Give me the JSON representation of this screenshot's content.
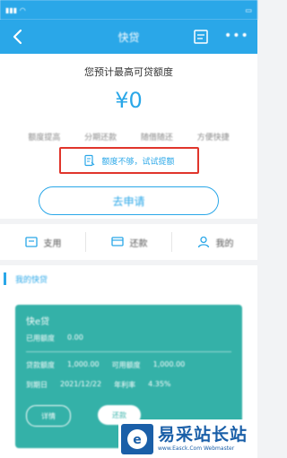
{
  "nav": {
    "title": "快贷"
  },
  "hero": {
    "label": "您预计最高可贷额度",
    "amount": "¥0",
    "features": [
      "额度提高",
      "分期还款",
      "随借随还",
      "方便快捷"
    ]
  },
  "boost": {
    "text": "额度不够，试试提额"
  },
  "apply_button": {
    "label": "去申请"
  },
  "tabs": [
    {
      "label": "支用",
      "icon": "wallet-icon"
    },
    {
      "label": "还款",
      "icon": "repay-icon"
    },
    {
      "label": "我的",
      "icon": "user-icon"
    }
  ],
  "section": {
    "title": "我的快贷"
  },
  "loan_card": {
    "name": "快e贷",
    "row1": [
      "已用额度",
      "0.00"
    ],
    "row2": [
      "贷款额度",
      "1,000.00",
      "可用额度",
      "1,000.00"
    ],
    "row3": [
      "到期日",
      "2021/12/22",
      "年利率",
      "4.35%"
    ],
    "btn1": "详情",
    "btn2": "还款"
  },
  "watermark": {
    "text": "易采站长站",
    "url": "www.Easck.Com Webmaster"
  },
  "colors": {
    "primary": "#2aa7e8",
    "highlight_border": "#e0352b",
    "card": "#34b1a8"
  }
}
